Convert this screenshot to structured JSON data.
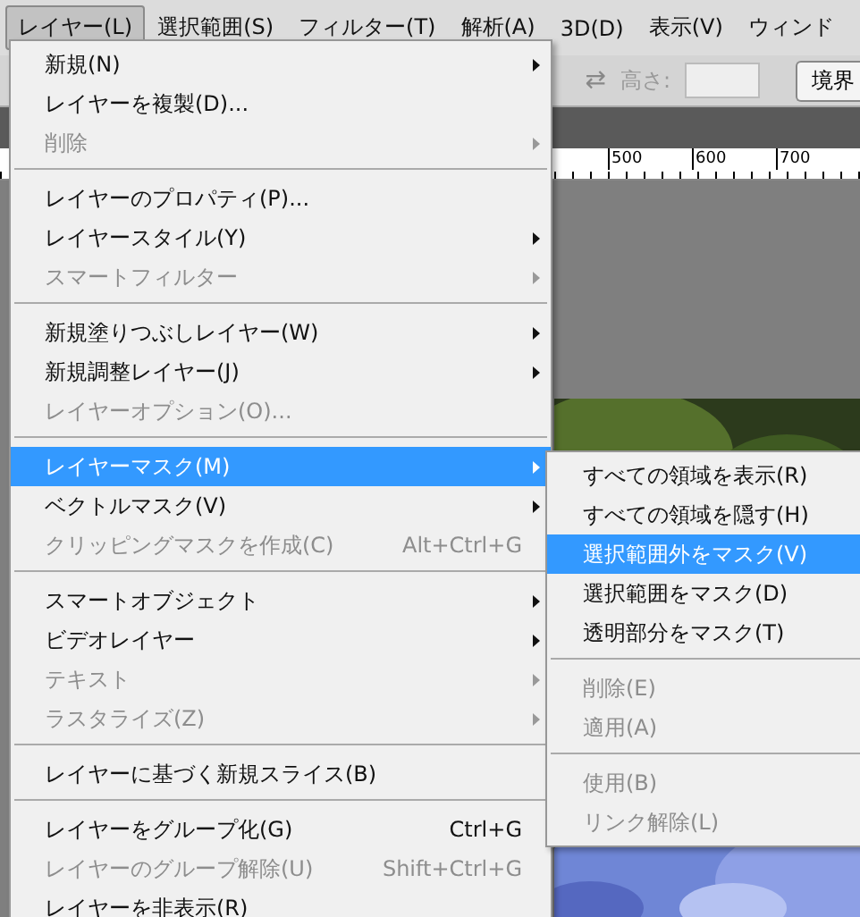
{
  "menubar": [
    {
      "label": "レイヤー(L)",
      "selected": true
    },
    {
      "label": "選択範囲(S)",
      "selected": false
    },
    {
      "label": "フィルター(T)",
      "selected": false
    },
    {
      "label": "解析(A)",
      "selected": false
    },
    {
      "label": "3D(D)",
      "selected": false
    },
    {
      "label": "表示(V)",
      "selected": false
    },
    {
      "label": "ウィンド",
      "selected": false
    }
  ],
  "options_bar": {
    "swap_symbol": "⇄",
    "height_label": "高さ:",
    "button": "境界"
  },
  "ruler": [
    "500",
    "600",
    "700"
  ],
  "menu": [
    {
      "kind": "item",
      "label": "新規(N)",
      "disabled": false,
      "submenu": true,
      "selected": false
    },
    {
      "kind": "item",
      "label": "レイヤーを複製(D)...",
      "disabled": false,
      "submenu": false,
      "selected": false
    },
    {
      "kind": "item",
      "label": "削除",
      "disabled": true,
      "submenu": true,
      "selected": false
    },
    {
      "kind": "separator"
    },
    {
      "kind": "item",
      "label": "レイヤーのプロパティ(P)...",
      "disabled": false,
      "submenu": false,
      "selected": false
    },
    {
      "kind": "item",
      "label": "レイヤースタイル(Y)",
      "disabled": false,
      "submenu": true,
      "selected": false
    },
    {
      "kind": "item",
      "label": "スマートフィルター",
      "disabled": true,
      "submenu": true,
      "selected": false
    },
    {
      "kind": "separator"
    },
    {
      "kind": "item",
      "label": "新規塗りつぶしレイヤー(W)",
      "disabled": false,
      "submenu": true,
      "selected": false
    },
    {
      "kind": "item",
      "label": "新規調整レイヤー(J)",
      "disabled": false,
      "submenu": true,
      "selected": false
    },
    {
      "kind": "item",
      "label": "レイヤーオプション(O)...",
      "disabled": true,
      "submenu": false,
      "selected": false
    },
    {
      "kind": "separator"
    },
    {
      "kind": "item",
      "label": "レイヤーマスク(M)",
      "disabled": false,
      "submenu": true,
      "selected": true
    },
    {
      "kind": "item",
      "label": "ベクトルマスク(V)",
      "disabled": false,
      "submenu": true,
      "selected": false
    },
    {
      "kind": "item",
      "label": "クリッピングマスクを作成(C)",
      "shortcut": "Alt+Ctrl+G",
      "disabled": true,
      "submenu": false,
      "selected": false
    },
    {
      "kind": "separator"
    },
    {
      "kind": "item",
      "label": "スマートオブジェクト",
      "disabled": false,
      "submenu": true,
      "selected": false
    },
    {
      "kind": "item",
      "label": "ビデオレイヤー",
      "disabled": false,
      "submenu": true,
      "selected": false
    },
    {
      "kind": "item",
      "label": "テキスト",
      "disabled": true,
      "submenu": true,
      "selected": false
    },
    {
      "kind": "item",
      "label": "ラスタライズ(Z)",
      "disabled": true,
      "submenu": true,
      "selected": false
    },
    {
      "kind": "separator"
    },
    {
      "kind": "item",
      "label": "レイヤーに基づく新規スライス(B)",
      "disabled": false,
      "submenu": false,
      "selected": false
    },
    {
      "kind": "separator"
    },
    {
      "kind": "item",
      "label": "レイヤーをグループ化(G)",
      "shortcut": "Ctrl+G",
      "disabled": false,
      "submenu": false,
      "selected": false
    },
    {
      "kind": "item",
      "label": "レイヤーのグループ解除(U)",
      "shortcut": "Shift+Ctrl+G",
      "disabled": true,
      "submenu": false,
      "selected": false
    },
    {
      "kind": "item",
      "label": "レイヤーを非表示(R)",
      "disabled": false,
      "submenu": false,
      "selected": false
    }
  ],
  "submenu": [
    {
      "kind": "item",
      "label": "すべての領域を表示(R)",
      "disabled": false,
      "selected": false
    },
    {
      "kind": "item",
      "label": "すべての領域を隠す(H)",
      "disabled": false,
      "selected": false
    },
    {
      "kind": "item",
      "label": "選択範囲外をマスク(V)",
      "disabled": false,
      "selected": true
    },
    {
      "kind": "item",
      "label": "選択範囲をマスク(D)",
      "disabled": false,
      "selected": false
    },
    {
      "kind": "item",
      "label": "透明部分をマスク(T)",
      "disabled": false,
      "selected": false
    },
    {
      "kind": "separator"
    },
    {
      "kind": "item",
      "label": "削除(E)",
      "disabled": true,
      "selected": false
    },
    {
      "kind": "item",
      "label": "適用(A)",
      "disabled": true,
      "selected": false
    },
    {
      "kind": "separator"
    },
    {
      "kind": "item",
      "label": "使用(B)",
      "disabled": true,
      "selected": false
    },
    {
      "kind": "item",
      "label": "リンク解除(L)",
      "disabled": true,
      "selected": false
    }
  ]
}
